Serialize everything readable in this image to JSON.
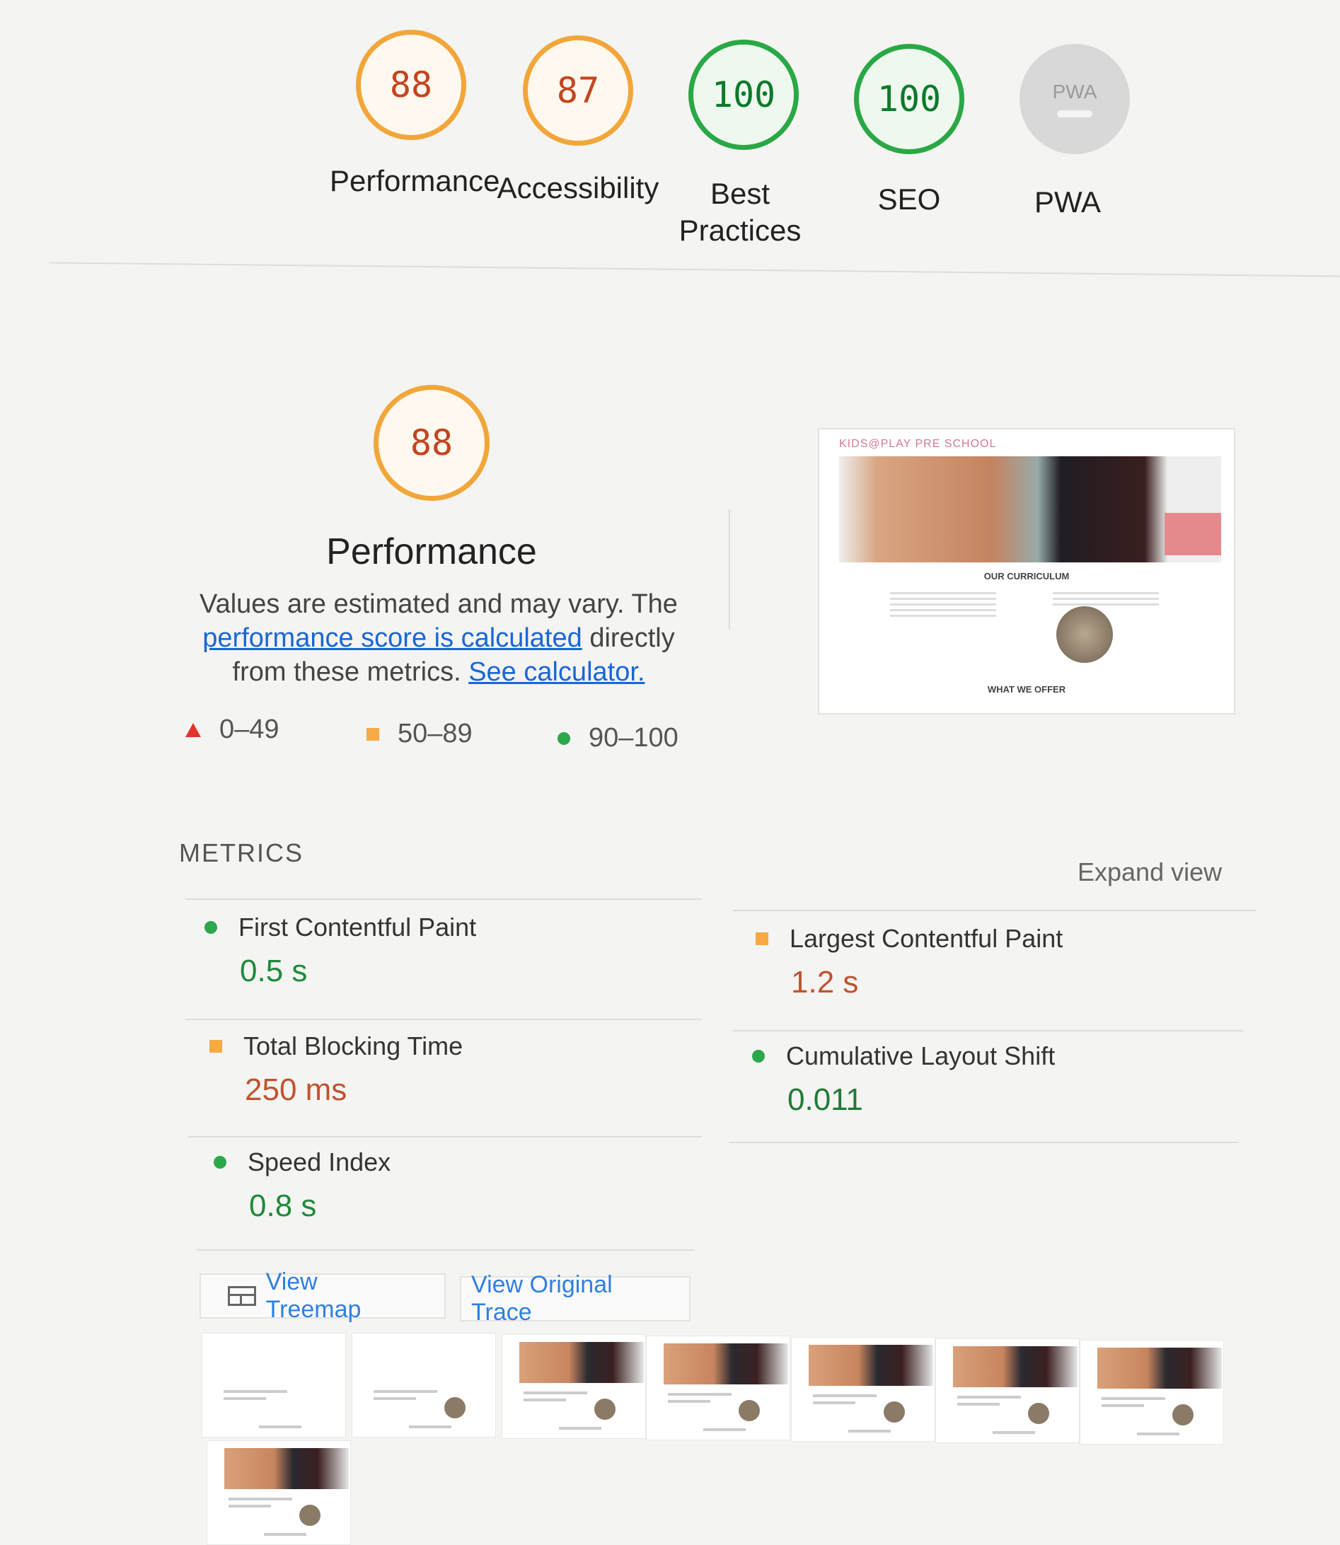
{
  "categories": [
    {
      "label": "Performance",
      "score": "88",
      "rating": "average"
    },
    {
      "label": "Accessibility",
      "score": "87",
      "rating": "average"
    },
    {
      "label": "Best Practices",
      "score": "100",
      "rating": "pass"
    },
    {
      "label": "SEO",
      "score": "100",
      "rating": "pass"
    },
    {
      "label": "PWA",
      "score": "PWA",
      "rating": "not-applicable"
    }
  ],
  "performance": {
    "score": "88",
    "title": "Performance",
    "desc_prefix": "Values are estimated and may vary. The",
    "desc_link1": "performance score is calculated",
    "desc_mid": "directly from these metrics.",
    "desc_link2": "See calculator.",
    "legend": [
      {
        "range": "0–49",
        "icon": "triangle-icon",
        "color": "#e0352b"
      },
      {
        "range": "50–89",
        "icon": "square-icon",
        "color": "#f6a945"
      },
      {
        "range": "90–100",
        "icon": "circle-icon",
        "color": "#2ba84a"
      }
    ]
  },
  "screenshot": {
    "site_title": "KIDS@PLAY PRE SCHOOL",
    "heading1": "OUR CURRICULUM",
    "heading2": "WHAT WE OFFER"
  },
  "metrics": {
    "header": "METRICS",
    "expand": "Expand view",
    "items": [
      {
        "label": "First Contentful Paint",
        "value": "0.5 s",
        "rating": "pass"
      },
      {
        "label": "Largest Contentful Paint",
        "value": "1.2 s",
        "rating": "average"
      },
      {
        "label": "Total Blocking Time",
        "value": "250 ms",
        "rating": "average"
      },
      {
        "label": "Cumulative Layout Shift",
        "value": "0.011",
        "rating": "pass"
      },
      {
        "label": "Speed Index",
        "value": "0.8 s",
        "rating": "pass"
      }
    ]
  },
  "buttons": {
    "treemap": "View Treemap",
    "trace": "View Original Trace"
  },
  "colors": {
    "pass": "#2ba84a",
    "average": "#f2a63a",
    "fail": "#e0352b",
    "link": "#1a66d6"
  }
}
